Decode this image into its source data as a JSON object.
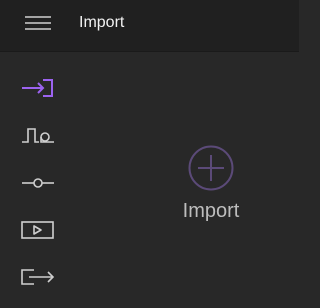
{
  "header": {
    "title": "Import",
    "menu_icon": "hamburger-menu-icon"
  },
  "sidebar": {
    "items": [
      {
        "id": "import",
        "icon": "import-icon",
        "active": true
      },
      {
        "id": "signal",
        "icon": "waveform-signal-icon",
        "active": false
      },
      {
        "id": "settings",
        "icon": "slider-line-icon",
        "active": false
      },
      {
        "id": "play",
        "icon": "play-box-icon",
        "active": false
      },
      {
        "id": "export",
        "icon": "export-icon",
        "active": false
      }
    ]
  },
  "main": {
    "import_label": "Import",
    "import_icon": "plus-circle-icon"
  },
  "colors": {
    "accent": "#9c63f0",
    "icon": "#cfcfcf",
    "circle": "#5b4a78",
    "text": "#bdbdbd",
    "background": "#282828",
    "header": "#202020"
  }
}
